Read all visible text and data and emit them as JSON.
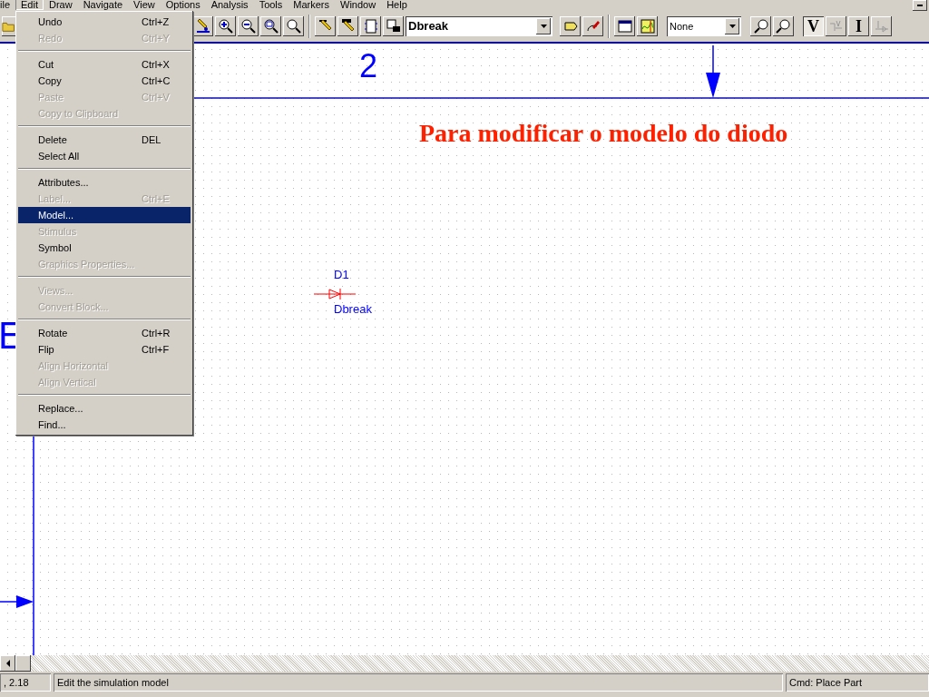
{
  "menubar": [
    {
      "label": "ile",
      "selected": false
    },
    {
      "label": "Edit",
      "selected": true
    },
    {
      "label": "Draw",
      "selected": false
    },
    {
      "label": "Navigate",
      "selected": false
    },
    {
      "label": "View",
      "selected": false
    },
    {
      "label": "Options",
      "selected": false
    },
    {
      "label": "Analysis",
      "selected": false
    },
    {
      "label": "Tools",
      "selected": false
    },
    {
      "label": "Markers",
      "selected": false
    },
    {
      "label": "Window",
      "selected": false
    },
    {
      "label": "Help",
      "selected": false
    }
  ],
  "edit_menu": [
    {
      "kind": "item",
      "label": "Undo",
      "shortcut": "Ctrl+Z",
      "disabled": false,
      "selected": false
    },
    {
      "kind": "item",
      "label": "Redo",
      "shortcut": "Ctrl+Y",
      "disabled": true,
      "selected": false
    },
    {
      "kind": "separator"
    },
    {
      "kind": "item",
      "label": "Cut",
      "shortcut": "Ctrl+X",
      "disabled": false,
      "selected": false
    },
    {
      "kind": "item",
      "label": "Copy",
      "shortcut": "Ctrl+C",
      "disabled": false,
      "selected": false
    },
    {
      "kind": "item",
      "label": "Paste",
      "shortcut": "Ctrl+V",
      "disabled": true,
      "selected": false
    },
    {
      "kind": "item",
      "label": "Copy to Clipboard",
      "disabled": true,
      "selected": false
    },
    {
      "kind": "separator"
    },
    {
      "kind": "item",
      "label": "Delete",
      "shortcut": "DEL",
      "disabled": false,
      "selected": false
    },
    {
      "kind": "item",
      "label": "Select All",
      "disabled": false,
      "selected": false
    },
    {
      "kind": "separator"
    },
    {
      "kind": "item",
      "label": "Attributes...",
      "disabled": false,
      "selected": false
    },
    {
      "kind": "item",
      "label": "Label...",
      "shortcut": "Ctrl+E",
      "disabled": true,
      "selected": false
    },
    {
      "kind": "item",
      "label": "Model...",
      "disabled": false,
      "selected": true
    },
    {
      "kind": "item",
      "label": "Stimulus",
      "disabled": true,
      "selected": false
    },
    {
      "kind": "item",
      "label": "Symbol",
      "disabled": false,
      "selected": false
    },
    {
      "kind": "item",
      "label": "Graphics Properties...",
      "disabled": true,
      "selected": false
    },
    {
      "kind": "separator"
    },
    {
      "kind": "item",
      "label": "Views...",
      "disabled": true,
      "selected": false
    },
    {
      "kind": "item",
      "label": "Convert Block...",
      "disabled": true,
      "selected": false
    },
    {
      "kind": "separator"
    },
    {
      "kind": "item",
      "label": "Rotate",
      "shortcut": "Ctrl+R",
      "disabled": false,
      "selected": false
    },
    {
      "kind": "item",
      "label": "Flip",
      "shortcut": "Ctrl+F",
      "disabled": false,
      "selected": false
    },
    {
      "kind": "item",
      "label": "Align Horizontal",
      "disabled": true,
      "selected": false
    },
    {
      "kind": "item",
      "label": "Align Vertical",
      "disabled": true,
      "selected": false
    },
    {
      "kind": "separator"
    },
    {
      "kind": "item",
      "label": "Replace...",
      "disabled": false,
      "selected": false
    },
    {
      "kind": "item",
      "label": "Find...",
      "disabled": false,
      "selected": false
    }
  ],
  "toolbar": {
    "part_combo": "Dbreak",
    "marker_combo": "None",
    "probe_buttons": [
      {
        "label": "V",
        "selected": true
      },
      {
        "label": "I",
        "selected": false
      }
    ]
  },
  "schematic": {
    "heading": "Para modificar o modelo do diodo",
    "sheet_number": "2",
    "left_label": "E",
    "diode": {
      "refdes": "D1",
      "model": "Dbreak"
    }
  },
  "status_bar": {
    "coords": ", 2.18",
    "message": "Edit the simulation model",
    "command": "Cmd: Place Part"
  }
}
